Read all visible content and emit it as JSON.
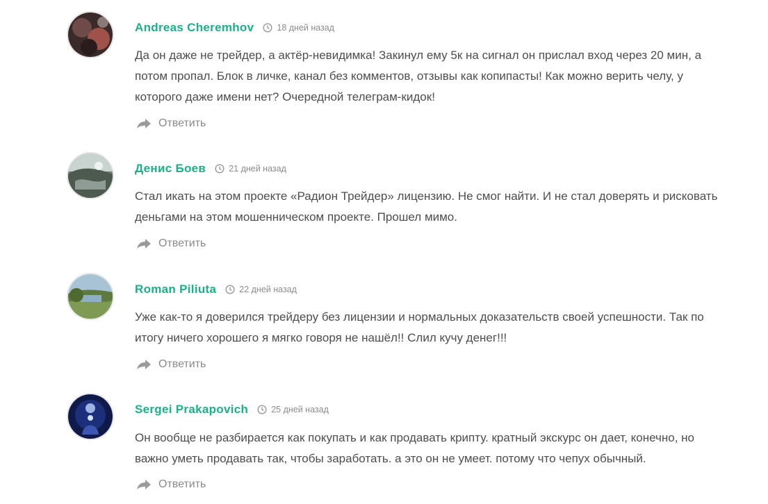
{
  "comments": [
    {
      "author": "Andreas Cheremhov",
      "date": "18 дней назад",
      "text": "Да он даже не трейдер, а актёр-невидимка! Закинул ему 5к на сигнал он прислал вход через 20 мин, а потом пропал. Блок в личке, канал без комментов, отзывы как копипасты! Как можно верить челу, у которого даже имени нет? Очередной телеграм-кидок!",
      "reply_label": "Ответить"
    },
    {
      "author": "Денис Боев",
      "date": "21 дней назад",
      "text": "Стал икать на этом проекте «Радион Трейдер» лицензию. Не смог найти. И не стал доверять и рисковать деньгами на этом мошенническом проекте. Прошел мимо.",
      "reply_label": "Ответить"
    },
    {
      "author": "Roman Piliuta",
      "date": "22 дней назад",
      "text": "Уже как-то я доверился трейдеру без лицензии и нормальных доказательств своей успешности. Так по итогу ничего хорошего я мягко говоря не нашёл!! Слил кучу денег!!!",
      "reply_label": "Ответить"
    },
    {
      "author": "Sergei Prakapovich",
      "date": "25 дней назад",
      "text": "Он вообще не разбирается как покупать и как продавать крипту. кратный экскурс он дает, конечно, но важно уметь продавать так, чтобы заработать. а это он не умеет. потому что чепух обычный.",
      "reply_label": "Ответить"
    }
  ],
  "colors": {
    "author": "#1bb088",
    "text": "#4d4d4d",
    "meta": "#8c8c8c",
    "reply": "#8a8a8a"
  },
  "icons": {
    "clock": "clock-icon",
    "reply": "reply-arrow-icon"
  }
}
